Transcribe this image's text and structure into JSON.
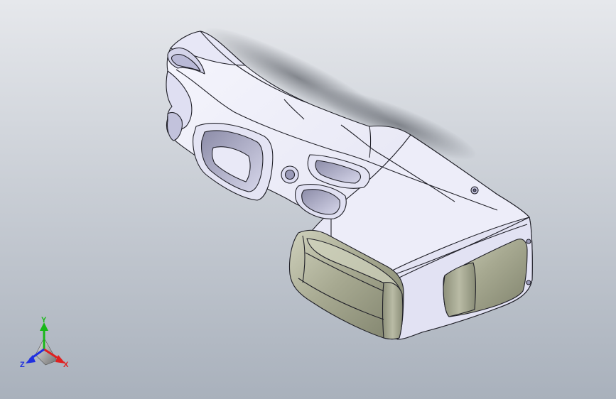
{
  "viewport": {
    "background_top": "#e6e8ec",
    "background_bottom": "#a9b1bc"
  },
  "model": {
    "body_color": "#f2f2fb",
    "body_shade": "#d8d8ec",
    "edge_color": "#202028",
    "cap_color": "#a7a991",
    "cap_highlight": "#cfd1bc",
    "cap_shadow": "#7f826c"
  },
  "triad": {
    "x_label": "X",
    "y_label": "Y",
    "z_label": "Z",
    "x_color": "#e02020",
    "y_color": "#18b818",
    "z_color": "#2030e0"
  }
}
